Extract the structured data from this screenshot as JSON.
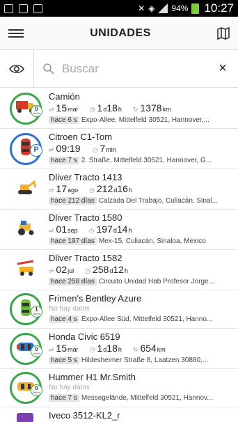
{
  "status_bar": {
    "battery": "94%",
    "time": "10:27"
  },
  "header": {
    "title": "UNIDADES"
  },
  "search": {
    "placeholder": "Buscar",
    "clear": "×"
  },
  "units": [
    {
      "name": "Camión",
      "type": "truck-red",
      "ring": "green",
      "badge": "speed",
      "speed": "0",
      "speed_unit": "km/h",
      "date_num": "15",
      "date_sfx": "mar",
      "dur_a": "1",
      "dur_a_u": "d",
      "dur_b": "18",
      "dur_b_u": "h",
      "dist": "1378",
      "dist_u": "km",
      "ago": "hace 6 s",
      "address": "Expo-Allee, Mittelfeld 30521, Hannover,..."
    },
    {
      "name": "Citroen C1-Tom",
      "type": "car-red",
      "ring": "blue",
      "badge": "park",
      "park_label": "P",
      "date_num": "09:19",
      "date_sfx": "",
      "dur_a": "7",
      "dur_a_u": "min",
      "dur_b": "",
      "dur_b_u": "",
      "dist": "",
      "dist_u": "",
      "ago": "hace 7 s",
      "address": "2. Straße, Mittelfeld 30521, Hannover, G..."
    },
    {
      "name": "Dliver Tracto 1413",
      "type": "excavator",
      "ring": "none",
      "badge": "none",
      "date_num": "17",
      "date_sfx": "ago",
      "dur_a": "212",
      "dur_a_u": "d",
      "dur_b": "16",
      "dur_b_u": "h",
      "dist": "",
      "dist_u": "",
      "ago": "hace 212 días",
      "address": "Calzada Del Trabajo, Culiacán, Sinal..."
    },
    {
      "name": "Dliver Tracto 1580",
      "type": "tractor",
      "ring": "none",
      "badge": "none",
      "date_num": "01",
      "date_sfx": "sep",
      "dur_a": "197",
      "dur_a_u": "d",
      "dur_b": "14",
      "dur_b_u": "h",
      "dist": "",
      "dist_u": "",
      "ago": "hace 197 días",
      "address": "Mex-15, Culiacán, Sinaloa, Mexico"
    },
    {
      "name": "Dliver Tracto 1582",
      "type": "crane",
      "ring": "none",
      "badge": "none",
      "date_num": "02",
      "date_sfx": "jul",
      "dur_a": "258",
      "dur_a_u": "d",
      "dur_b": "12",
      "dur_b_u": "h",
      "dist": "",
      "dist_u": "",
      "ago": "hace 258 días",
      "address": "Circuito Unidad Hab Profesor Jorge..."
    },
    {
      "name": "Frimen's Bentley Azure",
      "type": "car-green",
      "ring": "green",
      "badge": "speed",
      "speed": "1",
      "speed_unit": "km/h",
      "nodata": "No hay datos",
      "ago": "hace 4 s",
      "address": "Expo-Allee Süd, Mittelfeld 30521, Hanno..."
    },
    {
      "name": "Honda Civic 6519",
      "type": "car-blue",
      "ring": "green",
      "badge": "speed",
      "speed": "0",
      "speed_unit": "km/h",
      "date_num": "15",
      "date_sfx": "mar",
      "dur_a": "1",
      "dur_a_u": "d",
      "dur_b": "18",
      "dur_b_u": "h",
      "dist": "654",
      "dist_u": "km",
      "ago": "hace 5 s",
      "address": "Hildesheimer Straße 8, Laatzen 30880,..."
    },
    {
      "name": "Hummer H1 Mr.Smith",
      "type": "car-yellow",
      "ring": "green",
      "badge": "speed",
      "speed": "0",
      "speed_unit": "km/h",
      "nodata": "No hay datos",
      "ago": "hace 7 s",
      "address": "Messegelände, Mittelfeld 30521, Hannov..."
    },
    {
      "name": "Iveco 3512-KL2_r",
      "type": "truck-purple",
      "ring": "none",
      "badge": "none",
      "partial": true
    }
  ]
}
